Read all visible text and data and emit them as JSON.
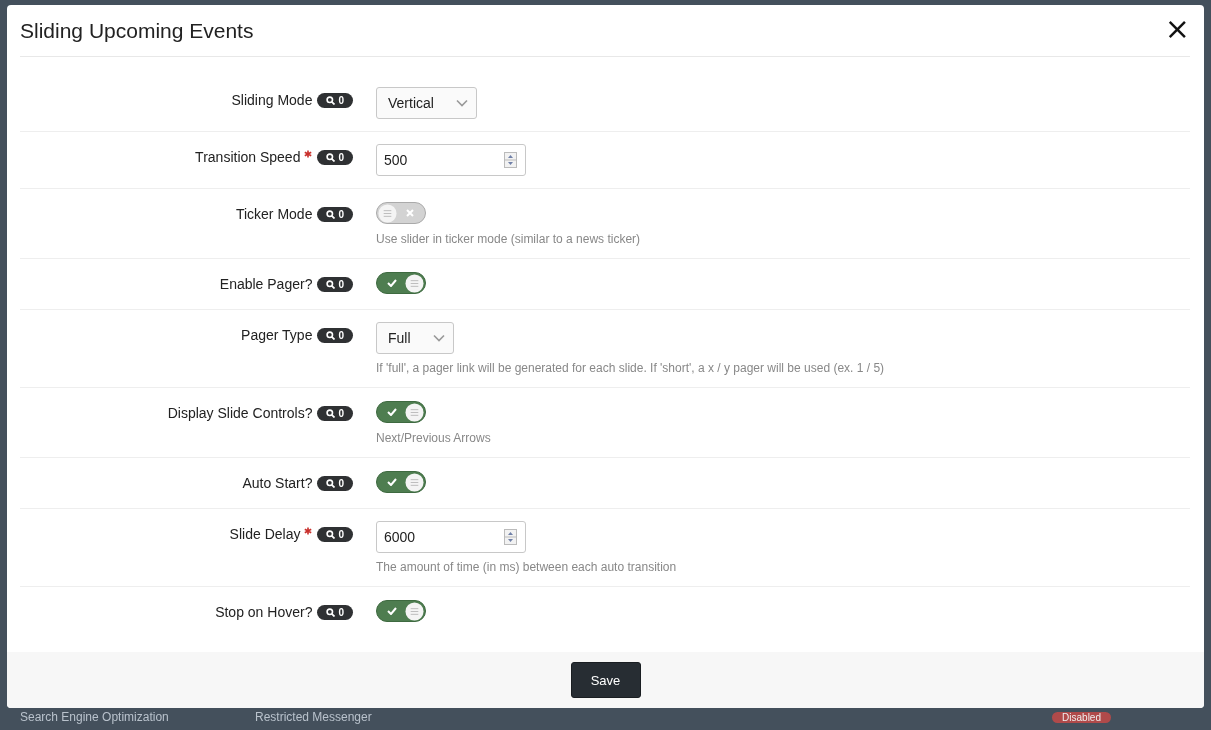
{
  "dialog": {
    "title": "Sliding Upcoming Events",
    "close": "×"
  },
  "fields": [
    {
      "kind": "select",
      "label": "Sliding Mode",
      "required": false,
      "badge": "0",
      "value": "Vertical"
    },
    {
      "kind": "number",
      "label": "Transition Speed",
      "required": true,
      "badge": "0",
      "value": "500"
    },
    {
      "kind": "toggle",
      "label": "Ticker Mode",
      "required": false,
      "badge": "0",
      "on": false,
      "help": "Use slider in ticker mode (similar to a news ticker)"
    },
    {
      "kind": "toggle",
      "label": "Enable Pager?",
      "required": false,
      "badge": "0",
      "on": true
    },
    {
      "kind": "select",
      "label": "Pager Type",
      "required": false,
      "badge": "0",
      "value": "Full",
      "help": "If 'full', a pager link will be generated for each slide. If 'short', a x / y pager will be used (ex. 1 / 5)"
    },
    {
      "kind": "toggle",
      "label": "Display Slide Controls?",
      "required": false,
      "badge": "0",
      "on": true,
      "help": "Next/Previous Arrows"
    },
    {
      "kind": "toggle",
      "label": "Auto Start?",
      "required": false,
      "badge": "0",
      "on": true
    },
    {
      "kind": "number",
      "label": "Slide Delay",
      "required": true,
      "badge": "0",
      "value": "6000",
      "help": "The amount of time (in ms) between each auto transition"
    },
    {
      "kind": "toggle",
      "label": "Stop on Hover?",
      "required": false,
      "badge": "0",
      "on": true
    }
  ],
  "footer": {
    "button": "Save"
  },
  "background": {
    "sidebar_item": "Search Engine Optimization",
    "list_item": "Restricted Messenger",
    "status": "Disabled"
  }
}
